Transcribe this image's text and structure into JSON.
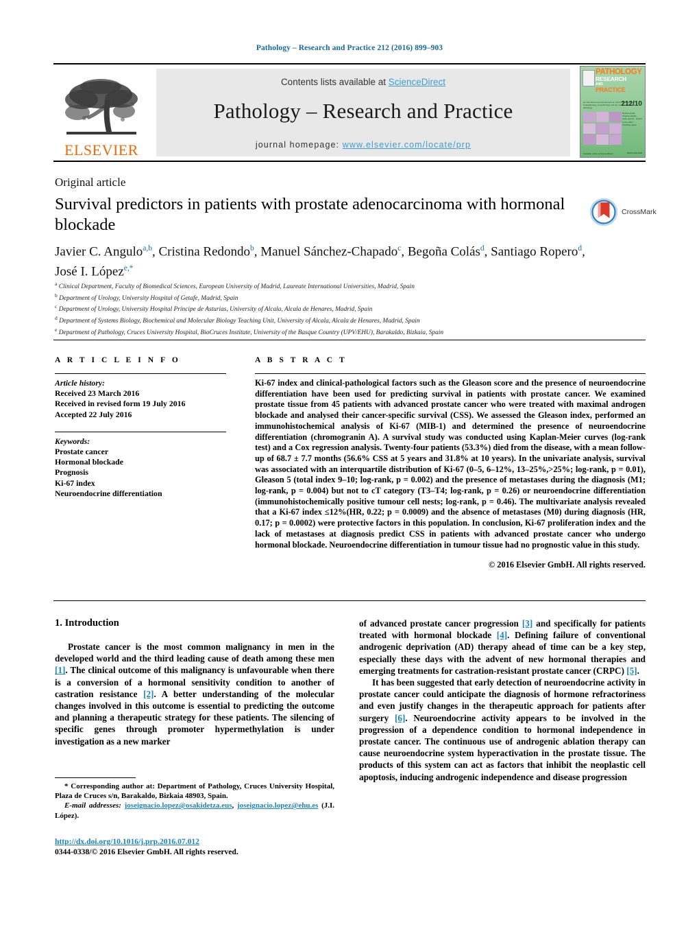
{
  "running_head": "Pathology – Research and Practice 212 (2016) 899–903",
  "masthead": {
    "contents_prefix": "Contents lists available at ",
    "sciencedirect": "ScienceDirect",
    "journal_name": "Pathology – Research and Practice",
    "homepage_prefix": "journal homepage: ",
    "homepage_url": "www.elsevier.com/locate/prp",
    "publisher_wordmark": "ELSEVIER",
    "publisher_accent_color": "#eb6a09",
    "link_color": "#3c9dd0"
  },
  "cover": {
    "line1": "PATHOLOGY",
    "line2": "RESEARCH",
    "line3": "AND",
    "line4": "PRACTICE",
    "issue": "212/10",
    "subtitle": "an international journal devoted to reports of research in histopathology, cytopathology and the molecular basis of pathology",
    "sidebar": "Review article · Original articles · Case reports · Letters to the editor · Teaching cases",
    "footer": "Available online at ScienceDirect",
    "footer2": "ISSN 0344-0338",
    "bg_color": "#8ec894",
    "accent_color": "#ff7a1a"
  },
  "article": {
    "type": "Original article",
    "title": "Survival predictors in patients with prostate adenocarcinoma with hormonal blockade",
    "crossmark_label": "CrossMark",
    "authors": [
      {
        "name": "Javier C. Angulo",
        "sup": "a,b",
        "sep": ", "
      },
      {
        "name": "Cristina Redondo",
        "sup": "b",
        "sep": ", "
      },
      {
        "name": "Manuel Sánchez-Chapado",
        "sup": "c",
        "sep": ", "
      },
      {
        "name": "Begoña Colás",
        "sup": "d",
        "sep": ", "
      },
      {
        "name": "Santiago Ropero",
        "sup": "d",
        "sep": ", "
      },
      {
        "name": "José I. López",
        "sup": "e,*",
        "sep": ""
      }
    ],
    "affiliations": [
      {
        "mark": "a",
        "text": "Clinical Department, Faculty of Biomedical Sciences, European University of Madrid, Laureate International Universities, Madrid, Spain"
      },
      {
        "mark": "b",
        "text": "Department of Urology, University Hospital of Getafe, Madrid, Spain"
      },
      {
        "mark": "c",
        "text": "Department of Urology, University Hospital Príncipe de Asturias, University of Alcala, Alcala de Henares, Madrid, Spain"
      },
      {
        "mark": "d",
        "text": "Department of Systems Biology, Biochemical and Molecular Biology Teaching Unit, University of Alcala, Alcala de Henares, Madrid, Spain"
      },
      {
        "mark": "e",
        "text": "Department of Pathology, Cruces University Hospital, BioCruces Institute, University of the Basque Country (UPV/EHU), Barakaldo, Bizkaia, Spain"
      }
    ]
  },
  "article_info": {
    "heading": "A R T I C L E  I N F O",
    "history_label": "Article history:",
    "history": [
      "Received 23 March 2016",
      "Received in revised form 19 July 2016",
      "Accepted 22 July 2016"
    ],
    "keywords_label": "Keywords:",
    "keywords": [
      "Prostate cancer",
      "Hormonal blockade",
      "Prognosis",
      "Ki-67 index",
      "Neuroendocrine differentiation"
    ]
  },
  "abstract": {
    "heading": "A B S T R A C T",
    "text": "Ki-67 index and clinical-pathological factors such as the Gleason score and the presence of neuroendocrine differentiation have been used for predicting survival in patients with prostate cancer. We examined prostate tissue from 45 patients with advanced prostate cancer who were treated with maximal androgen blockade and analysed their cancer-specific survival (CSS). We assessed the Gleason index, performed an immunohistochemical analysis of Ki-67 (MIB-1) and determined the presence of neuroendocrine differentiation (chromogranin A). A survival study was conducted using Kaplan-Meier curves (log-rank test) and a Cox regression analysis. Twenty-four patients (53.3%) died from the disease, with a mean follow-up of 68.7 ± 7.7 months (56.6% CSS at 5 years and 31.8% at 10 years). In the univariate analysis, survival was associated with an interquartile distribution of Ki-67 (0–5, 6–12%, 13–25%,>25%; log-rank, p = 0.01), Gleason 5 (total index 9–10; log-rank, p = 0.002) and the presence of metastases during the diagnosis (M1; log-rank, p = 0.004) but not to cT category (T3–T4; log-rank, p = 0.26) or neuroendocrine differentiation (immunohistochemically positive tumour cell nests; log-rank, p = 0.46). The multivariate analysis revealed that a Ki-67 index ≤12%(HR, 0.22; p = 0.0009) and the absence of metastases (M0) during diagnosis (HR, 0.17; p = 0.0002) were protective factors in this population. In conclusion, Ki-67 proliferation index and the lack of metastases at diagnosis predict CSS in patients with advanced prostate cancer who undergo hormonal blockade. Neuroendocrine differentiation in tumour tissue had no prognostic value in this study.",
    "copyright": "© 2016 Elsevier GmbH. All rights reserved."
  },
  "introduction": {
    "heading": "1.  Introduction",
    "left_para_1_a": "Prostate cancer is the most common malignancy in men in the developed world and the third leading cause of death among these men ",
    "left_para_1_ref1": "[1]",
    "left_para_1_b": ". The clinical outcome of this malignancy is unfavourable when there is a conversion of a hormonal sensitivity condition to another of castration resistance ",
    "left_para_1_ref2": "[2]",
    "left_para_1_c": ". A better understanding of the molecular changes involved in this outcome is essential to predicting the outcome and planning a therapeutic strategy for these patients. The silencing of specific genes through promoter hypermethylation is under investigation as a new marker",
    "right_para_1_a": "of advanced prostate cancer progression ",
    "right_para_1_ref3": "[3]",
    "right_para_1_b": " and specifically for patients treated with hormonal blockade ",
    "right_para_1_ref4": "[4]",
    "right_para_1_c": ". Defining failure of conventional androgenic deprivation (AD) therapy ahead of time can be a key step, especially these days with the advent of new hormonal therapies and emerging treatments for castration-resistant prostate cancer (CRPC) ",
    "right_para_1_ref5": "[5]",
    "right_para_1_d": ".",
    "right_para_2_a": "It has been suggested that early detection of neuroendocrine activity in prostate cancer could anticipate the diagnosis of hormone refractoriness and even justify changes in the therapeutic approach for patients after surgery ",
    "right_para_2_ref6": "[6]",
    "right_para_2_b": ". Neuroendocrine activity appears to be involved in the progression of a dependence condition to hormonal independence in prostate cancer. The continuous use of androgenic ablation therapy can cause neuroendocrine system hyperactivation in the prostate tissue. The products of this system can act as factors that inhibit the neoplastic cell apoptosis, inducing androgenic independence and disease progression"
  },
  "footnotes": {
    "corresponding": "* Corresponding author at: Department of Pathology, Cruces University Hospital, Plaza de Cruces s/n, Barakaldo, Bizkaia 48903, Spain.",
    "email_label": "E-mail addresses:",
    "email_1": "joseignacio.lopez@osakidetza.eus",
    "email_sep": ", ",
    "email_2": "joseignacio.lopez@ehu.es",
    "email_tail": "(J.I. López).",
    "doi": "http://dx.doi.org/10.1016/j.prp.2016.07.012",
    "issn_line": "0344-0338/© 2016 Elsevier GmbH. All rights reserved."
  }
}
